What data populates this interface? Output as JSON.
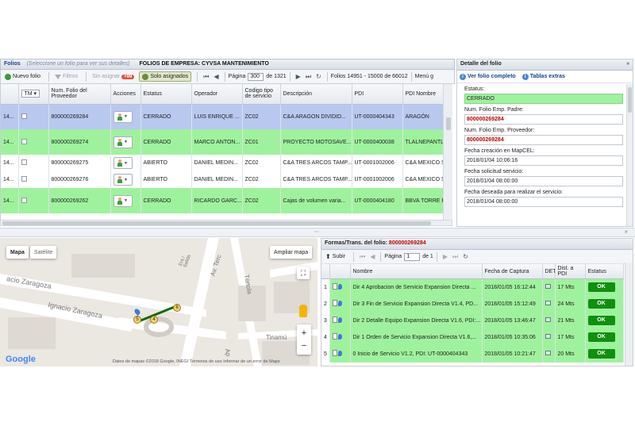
{
  "folios_panel": {
    "title": "Folios",
    "hint": "(Seleccione un folio para ver sus detalles)",
    "company": "FOLIOS DE EMPRESA: CYVSA MANTENIMIENTO"
  },
  "toolbar": {
    "nuevo_folio": "Nuevo folio",
    "filtros": "Filtros",
    "sin_asignar": "Sin asignar",
    "sin_asignar_count": "+99",
    "solo_asignados": "Solo asignados",
    "pagina_label": "Página",
    "pagina_value": "300",
    "of_label": "de 1321",
    "range": "Folios 14951 - 15000 de 66012",
    "menu": "Menú g"
  },
  "grid": {
    "columns": [
      "",
      "TM ▾",
      "Num. Folio del Proveedor",
      "Acciones",
      "Estatus",
      "Operador",
      "Codigo tipo de servicio",
      "Descripción",
      "PDI",
      "PDI Nombre"
    ],
    "rows": [
      {
        "id": "14...",
        "folio": "800000269284",
        "estatus": "CERRADO",
        "operador": "LUIS ENRIQUE ...",
        "codigo": "ZC02",
        "descripcion": "C&A ARAGON DIVIDID...",
        "pdi": "UT-0000404343",
        "pdi_nombre": "ARAGÓN",
        "style": "r-sel"
      },
      {
        "id": "14...",
        "folio": "800000269274",
        "estatus": "CERRADO",
        "operador": "MARCO ANTON...",
        "codigo": "ZC01",
        "descripcion": "PROYECTO MOTOSAVE...",
        "pdi": "UT-0000400038",
        "pdi_nombre": "TLALNEPANTLA",
        "style": "r-green"
      },
      {
        "id": "14...",
        "folio": "800000269275",
        "estatus": "ABIERTO",
        "operador": "DANIEL MEDIN...",
        "codigo": "ZC02",
        "descripcion": "C&A TRES ARCOS TAMP...",
        "pdi": "UT-0001002006",
        "pdi_nombre": "C&A MEXICO S",
        "style": "r-white"
      },
      {
        "id": "14...",
        "folio": "800000269276",
        "estatus": "ABIERTO",
        "operador": "DANIEL MEDIN...",
        "codigo": "ZC02",
        "descripcion": "C&A TRES ARCOS TAMP...",
        "pdi": "UT-0001002006",
        "pdi_nombre": "C&A MEXICO S",
        "style": "r-white"
      },
      {
        "id": "14...",
        "folio": "800000269262",
        "estatus": "CERRADO",
        "operador": "RICARDO GARC...",
        "codigo": "ZC02",
        "descripcion": "Cajas de volumen varia...",
        "pdi": "UT-0000404180",
        "pdi_nombre": "BBVA TORRE P(",
        "style": "r-green"
      }
    ]
  },
  "detail": {
    "title": "Detalle del folio",
    "tab_ver": "Ver folio completo",
    "tab_tablas": "Tablas extras",
    "fields": [
      {
        "label": "Estatus:",
        "value": "CERRADO",
        "style": "green"
      },
      {
        "label": "Num. Folio Emp. Padre:",
        "value": "800000269284",
        "style": "red"
      },
      {
        "label": "Num. Folio Emp. Proveedor:",
        "value": "800000269284",
        "style": "red"
      },
      {
        "label": "Fecha creación en MapCEL:",
        "value": "2018/01/04 10:06:16",
        "style": ""
      },
      {
        "label": "Fecha solicitud servicio:",
        "value": "2018/01/04 08:00:00",
        "style": ""
      },
      {
        "label": "Fecha deseada para realizar el servicio:",
        "value": "2018/01/04 08:00:00",
        "style": ""
      }
    ]
  },
  "map": {
    "tab_mapa": "Mapa",
    "tab_satelite": "Satélite",
    "ampliar": "Ampliar mapa",
    "zoom_in": "+",
    "zoom_out": "−",
    "google": "Google",
    "attribution": "Datos de mapas ©2018 Google, INEGI   Términos de uso   Informar de un error de Maps",
    "streets": {
      "zaragoza1": "Ignacio Zaragoza",
      "zaragoza2": "acio Zaragoza",
      "tercera": "Av. Terc",
      "tortola": "Tórtola",
      "tinamu": "Tinamú",
      "ent": "Ent./ Salida",
      "ap": "Ap"
    },
    "markers": [
      "5",
      "4",
      "8"
    ]
  },
  "formas": {
    "title_prefix": "Formas/Trans. del folio:",
    "title_folio": "800000269284",
    "subir": "Subir",
    "pagina_label": "Página",
    "pagina_value": "1",
    "of_label": "de 1",
    "columns": [
      "",
      "",
      "Nombre",
      "Fecha de Captura",
      "DET",
      "Dist. a PDI",
      "Estatus"
    ],
    "rows": [
      {
        "n": "1",
        "nombre": "Dir 4 Aprobacion de Servicio Expansion Directa ...",
        "fecha": "2018/01/05 16:12:44",
        "dist": "17 Mts",
        "estatus": "OK"
      },
      {
        "n": "2",
        "nombre": "Dir 3 Fin de Servicio Expansion Directa V1.4, PD...",
        "fecha": "2018/01/05 15:12:49",
        "dist": "24 Mts",
        "estatus": "OK"
      },
      {
        "n": "3",
        "nombre": "Dir 2 Detalle Equipo Expansion Directa V1.6, PDI:...",
        "fecha": "2018/01/05 13:46:47",
        "dist": "21 Mts",
        "estatus": "OK"
      },
      {
        "n": "4",
        "nombre": "Dir 1 Orden de Servicio Expansion Directa V1.6,...",
        "fecha": "2018/01/05 10:35:06",
        "dist": "17 Mts",
        "estatus": "OK"
      },
      {
        "n": "5",
        "nombre": "0 Inicio de Servicio V1.2, PDI: UT-0000404343",
        "fecha": "2018/01/05 10:21:47",
        "dist": "20 Mts",
        "estatus": "OK"
      }
    ]
  }
}
